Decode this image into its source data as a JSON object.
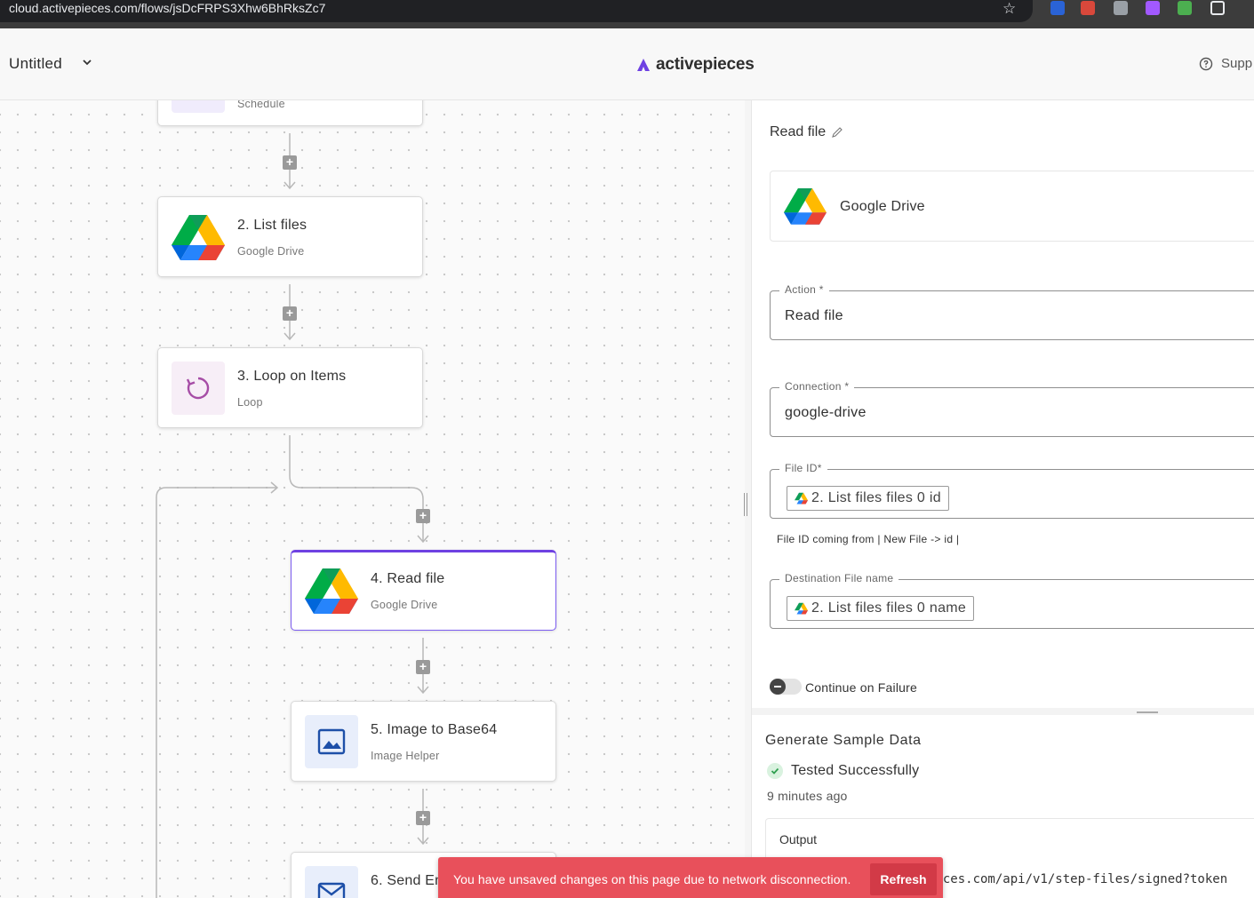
{
  "browser": {
    "url": "cloud.activepieces.com/flows/jsDcFRPS3Xhw6BhRksZc7"
  },
  "header": {
    "flow_name": "Untitled",
    "brand": "activepieces",
    "support_label": "Supp"
  },
  "canvas": {
    "steps": [
      {
        "title": "",
        "subtitle": "Schedule",
        "icon": "schedule-icon"
      },
      {
        "title": "2. List files",
        "subtitle": "Google Drive",
        "icon": "google-drive-icon"
      },
      {
        "title": "3. Loop on Items",
        "subtitle": "Loop",
        "icon": "loop-icon"
      },
      {
        "title": "4. Read file",
        "subtitle": "Google Drive",
        "icon": "google-drive-icon",
        "selected": true
      },
      {
        "title": "5. Image to Base64",
        "subtitle": "Image Helper",
        "icon": "image-icon"
      },
      {
        "title": "6. Send Em",
        "subtitle": "",
        "icon": "mail-icon"
      }
    ]
  },
  "panel": {
    "title": "Read file",
    "piece_name": "Google Drive",
    "action": {
      "label": "Action *",
      "value": "Read file"
    },
    "connection": {
      "label": "Connection *",
      "value": "google-drive"
    },
    "file_id": {
      "label": "File ID*",
      "chip": "2. List files files 0 id",
      "hint": "File ID coming from | New File -> id |"
    },
    "destination": {
      "label": "Destination File name",
      "chip": "2. List files files 0 name"
    },
    "continue_on_failure": "Continue on Failure",
    "generate_title": "Generate Sample Data",
    "tested_label": "Tested Successfully",
    "tested_time": "9 minutes ago",
    "output_label": "Output",
    "output_value": "https://cloud.activepieces.com/api/v1/step-files/signed?token"
  },
  "toast": {
    "message": "You have unsaved changes on this page due to network disconnection.",
    "action": "Refresh"
  },
  "colors": {
    "accent": "#6e41e2",
    "toast": "#e8505b",
    "success": "#2e9e4f"
  }
}
